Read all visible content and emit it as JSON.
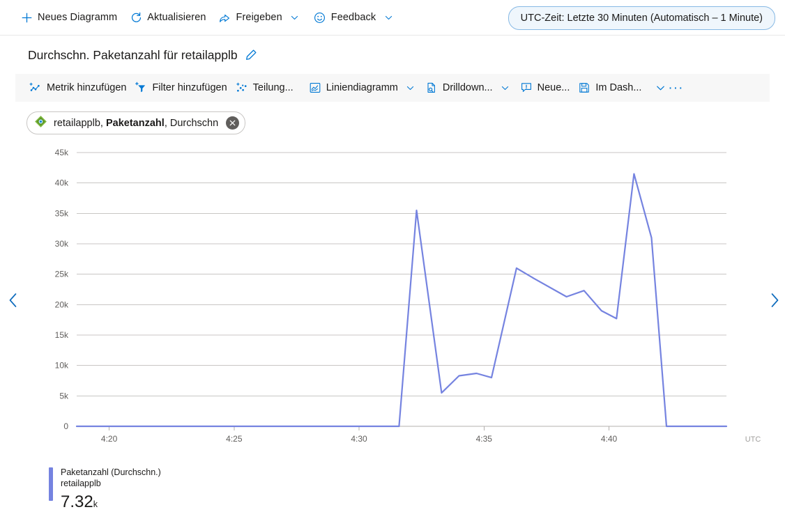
{
  "command_bar": {
    "buttons": [
      {
        "label": "Neues Diagramm",
        "icon": "plus-icon",
        "has_chevron": false
      },
      {
        "label": "Aktualisieren",
        "icon": "refresh-icon",
        "has_chevron": false
      },
      {
        "label": "Freigeben",
        "icon": "share-icon",
        "has_chevron": true
      },
      {
        "label": "Feedback",
        "icon": "smiley-icon",
        "has_chevron": true
      }
    ],
    "time_range": "UTC-Zeit: Letzte 30 Minuten (Automatisch – 1 Minute)"
  },
  "chart_header": {
    "title": "Durchschn. Paketanzahl für retailapplb",
    "edit_icon": "pencil-icon"
  },
  "metric_toolbar": {
    "buttons": [
      {
        "label": "Metrik hinzufügen",
        "icon": "add-metric-icon",
        "has_chevron": false
      },
      {
        "label": "Filter hinzufügen",
        "icon": "add-filter-icon",
        "has_chevron": false
      },
      {
        "label": "Teilung...",
        "icon": "splitting-icon",
        "has_chevron": false
      },
      {
        "label": "Liniendiagramm",
        "icon": "line-chart-icon",
        "has_chevron": true
      },
      {
        "label": "Drilldown...",
        "icon": "drilldown-icon",
        "has_chevron": true
      },
      {
        "label": "Neue...",
        "icon": "new-alert-icon",
        "has_chevron": false
      },
      {
        "label": "Im Dash...",
        "icon": "save-icon",
        "has_chevron": false
      }
    ],
    "overflow_chevron": "chevron-down-icon",
    "more_label": "···"
  },
  "metric_chip": {
    "resource": "retailapplb",
    "metric": "Paketanzahl",
    "aggregation": "Durchschn",
    "icon": "load-balancer-icon",
    "close_icon": "close-icon"
  },
  "navigation": {
    "prev_icon": "chevron-left-icon",
    "next_icon": "chevron-right-icon"
  },
  "legend": {
    "metric_label": "Paketanzahl (Durchschn.)",
    "resource_label": "retailapplb",
    "value": "7.32",
    "unit": "k",
    "color": "#7583e0"
  },
  "colors": {
    "accent": "#0078d4",
    "line": "#7583e0",
    "grid": "#c8c6c4",
    "toolbar_bg": "#f7f7f7",
    "pill_bg": "#eff6fc",
    "pill_border": "#86b8e4"
  },
  "chart_data": {
    "type": "line",
    "title": "Durchschn. Paketanzahl für retailapplb",
    "xlabel": "",
    "ylabel": "",
    "timezone_label": "UTC",
    "ylim": [
      0,
      45000
    ],
    "ytick_labels": [
      "0",
      "5k",
      "10k",
      "15k",
      "20k",
      "25k",
      "30k",
      "35k",
      "40k",
      "45k"
    ],
    "ytick_values": [
      0,
      5000,
      10000,
      15000,
      20000,
      25000,
      30000,
      35000,
      40000,
      45000
    ],
    "xtick_labels": [
      "4:20",
      "4:25",
      "4:30",
      "4:35",
      "4:40"
    ],
    "xtick_times": [
      260,
      265,
      270,
      275,
      280
    ],
    "xlim_times": [
      258.7,
      284.7
    ],
    "grid": true,
    "legend_position": "bottom-left",
    "series": [
      {
        "name": "Paketanzahl (Durchschn.) retailapplb",
        "color": "#7583e0",
        "x": [
          258.7,
          261.0,
          263.0,
          265.0,
          267.0,
          269.0,
          271.6,
          272.3,
          273.3,
          274.0,
          274.7,
          275.3,
          276.3,
          277.0,
          278.3,
          279.0,
          279.7,
          280.3,
          281.0,
          281.7,
          282.3,
          283.0,
          284.7
        ],
        "values": [
          0,
          0,
          0,
          0,
          0,
          0,
          0,
          35500,
          5500,
          8300,
          8700,
          8000,
          26000,
          24300,
          21300,
          22300,
          19000,
          17700,
          41500,
          31000,
          0,
          0,
          0
        ]
      }
    ]
  }
}
